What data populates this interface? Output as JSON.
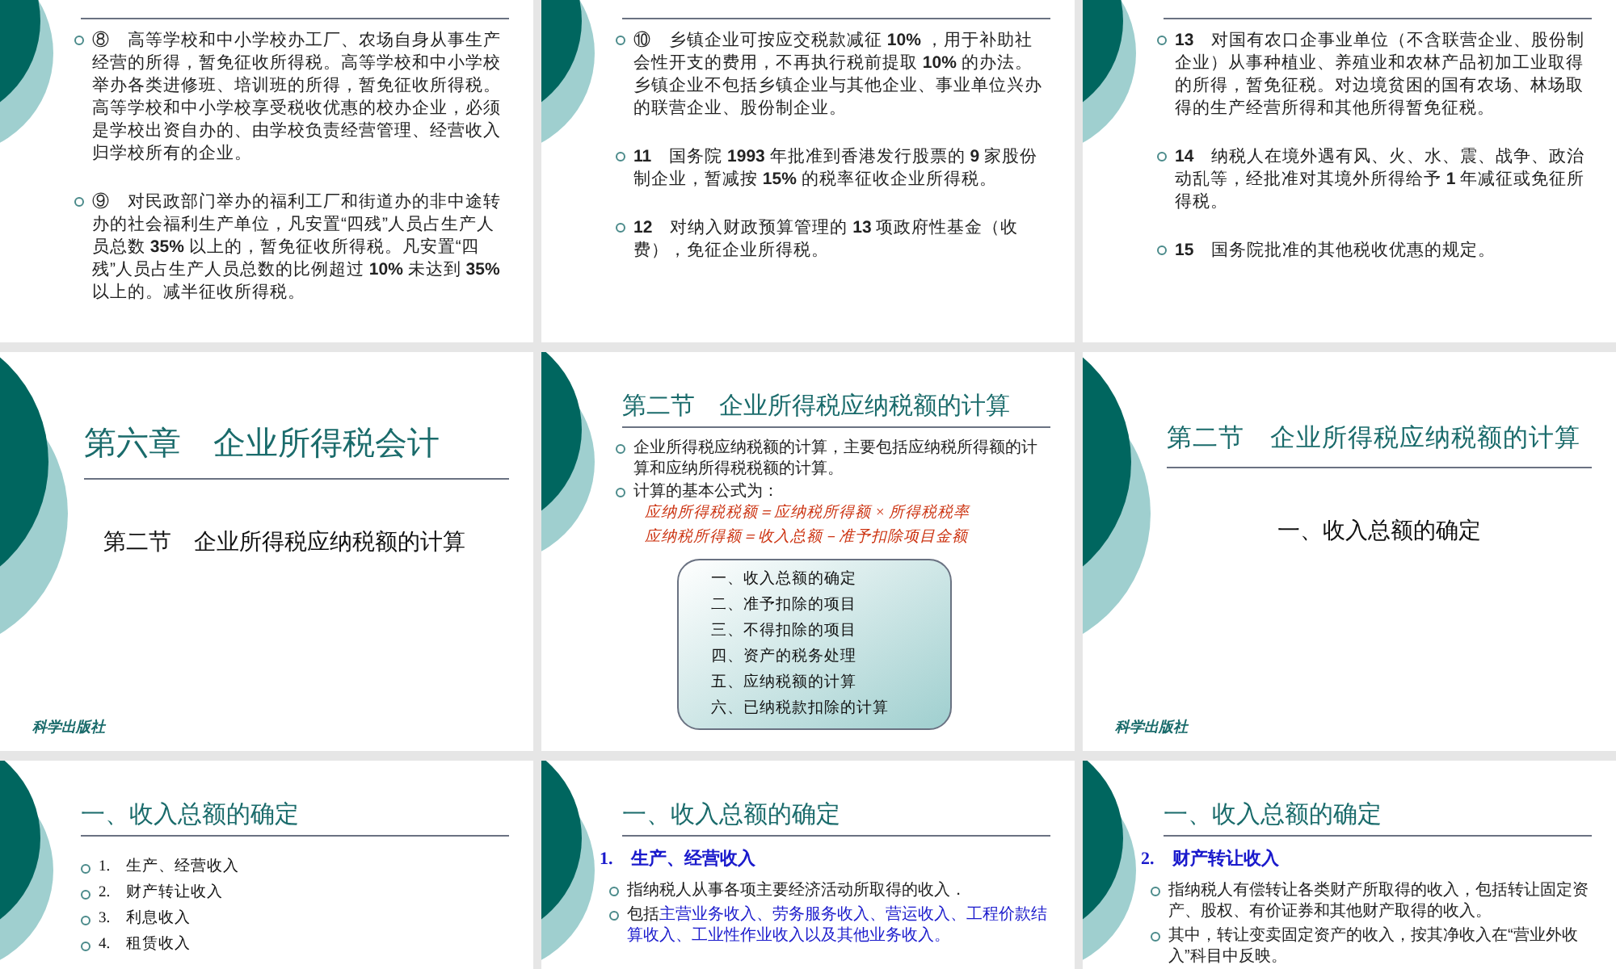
{
  "slides": [
    {
      "kind": "notes",
      "bullets": [
        "⑧　高等学校和中小学校办工厂、农场自身从事生产经营的所得，暂免征收所得税。高等学校和中小学校举办各类进修班、培训班的所得，暂免征收所得税。高等学校和中小学校享受税收优惠的校办企业，必须是学校出资自办的、由学校负责经营管理、经营收入归学校所有的企业。",
        "⑨　对民政部门举办的福利工厂和街道办的非中途转办的社会福利生产单位，凡安置“四残”人员占生产人员总数 **35%** 以上的，暂免征收所得税。凡安置“四残”人员占生产人员总数的比例超过 **10%** 未达到 **35%** 以上的。减半征收所得税。"
      ]
    },
    {
      "kind": "notes",
      "bullets": [
        "⑩　乡镇企业可按应交税款减征 **10%** ，用于补助社会性开支的费用，不再执行税前提取 **10%** 的办法。乡镇企业不包括乡镇企业与其他企业、事业单位兴办的联营企业、股份制企业。",
        "**11**　国务院 **1993** 年批准到香港发行股票的 **9** 家股份制企业，暂减按 **15%** 的税率征收企业所得税。",
        "**12**　对纳入财政预算管理的 **13** 项政府性基金（收费），免征企业所得税。"
      ]
    },
    {
      "kind": "notes",
      "bullets": [
        "**13**　对国有农口企事业单位（不含联营企业、股份制企业）从事种植业、养殖业和农林产品初加工业取得的所得，暂免征税。对边境贫困的国有农场、林场取得的生产经营所得和其他所得暂免征税。",
        "**14**　纳税人在境外遇有风、火、水、震、战争、政治动乱等，经批准对其境外所得给予 **1** 年减征或免征所得税。",
        "**15**　国务院批准的其他税收优惠的规定。"
      ]
    },
    {
      "kind": "cover",
      "title": "第六章　企业所得税会计",
      "subtitle": "第二节　企业所得税应纳税额的计算",
      "footer": "科学出版社"
    },
    {
      "kind": "overview",
      "title": "第二节　企业所得税应纳税额的计算",
      "bullets": [
        "企业所得税应纳税额的计算，主要包括应纳税所得额的计算和应纳所得税税额的计算。",
        "计算的基本公式为："
      ],
      "formulas": [
        "应纳所得税税额＝应纳税所得额 × 所得税税率",
        "应纳税所得额＝收入总额－准予扣除项目金额"
      ],
      "contents": [
        "一、收入总额的确定",
        "二、准予扣除的项目",
        "三、不得扣除的项目",
        "四、资产的税务处理",
        "五、应纳税额的计算",
        "六、已纳税款扣除的计算"
      ]
    },
    {
      "kind": "section",
      "title": "第二节　企业所得税应纳税额的计算",
      "subtitle": "一、收入总额的确定",
      "footer": "科学出版社"
    },
    {
      "kind": "list",
      "title": "一、收入总额的确定",
      "bullets": [
        "1.　生产、经营收入",
        "2.　财产转让收入",
        "3.　利息收入",
        "4.　租赁收入"
      ]
    },
    {
      "kind": "detail",
      "title": "一、收入总额的确定",
      "heading": "1.　生产、经营收入",
      "bullets": [
        [
          {
            "text": "指纳税人从事各项主要经济活动所取得的收入．",
            "highlight": false
          }
        ],
        [
          {
            "text": "包括",
            "highlight": false
          },
          {
            "text": "主营业务收入、劳务服务收入、营运收入、工程价款结算收入、工业性作业收入以及其他业务收入。",
            "highlight": true
          }
        ]
      ]
    },
    {
      "kind": "detail",
      "title": "一、收入总额的确定",
      "heading": "2.　财产转让收入",
      "bullets": [
        [
          {
            "text": "指纳税人有偿转让各类财产所取得的收入，包括转让固定资产、股权、有价证券和其他财产取得的收入。",
            "highlight": false
          }
        ],
        [
          {
            "text": "其中，转让变卖固定资产的收入，按其净收入在“营业外收入”科目中反映。",
            "highlight": false
          }
        ]
      ]
    }
  ]
}
